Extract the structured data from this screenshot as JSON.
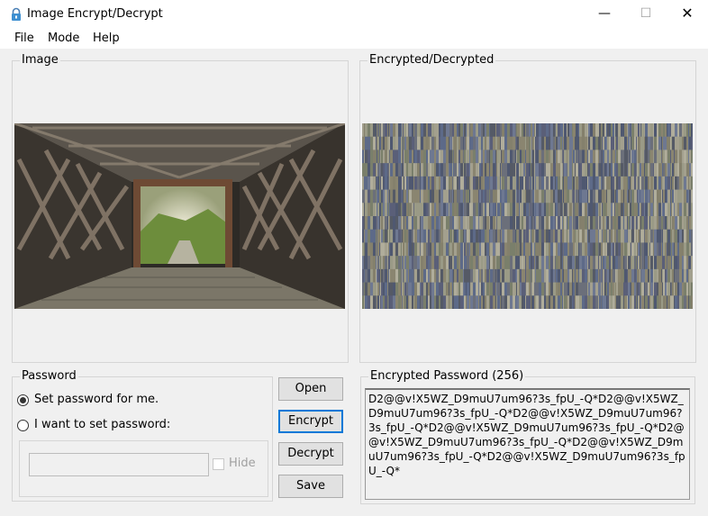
{
  "window": {
    "title": "Image Encrypt/Decrypt",
    "minimize": "—",
    "maximize": "☐",
    "close": "✕"
  },
  "menu": {
    "file": "File",
    "mode": "Mode",
    "help": "Help"
  },
  "image_panel": {
    "title": "Image"
  },
  "result_panel": {
    "title": "Encrypted/Decrypted"
  },
  "password_panel": {
    "title": "Password",
    "option_auto": "Set password for me.",
    "option_manual": "I want to set password:",
    "input_value": "",
    "hide_label": "Hide",
    "option_auto_selected": true,
    "hide_checked": false
  },
  "buttons": {
    "open": "Open",
    "encrypt": "Encrypt",
    "decrypt": "Decrypt",
    "save": "Save"
  },
  "encrypted_password": {
    "title": "Encrypted Password (256)",
    "value": "D2@@v!X5WZ_D9muU7um96?3s_fpU_-Q*D2@@v!X5WZ_D9muU7um96?3s_fpU_-Q*D2@@v!X5WZ_D9muU7um96?3s_fpU_-Q*D2@@v!X5WZ_D9muU7um96?3s_fpU_-Q*D2@@v!X5WZ_D9muU7um96?3s_fpU_-Q*D2@@v!X5WZ_D9muU7um96?3s_fpU_-Q*D2@@v!X5WZ_D9muU7um96?3s_fpU_-Q*"
  },
  "colors": {
    "window_bg": "#f0f0f0",
    "focus_border": "#0078d7",
    "disabled_text": "#a0a0a0"
  }
}
